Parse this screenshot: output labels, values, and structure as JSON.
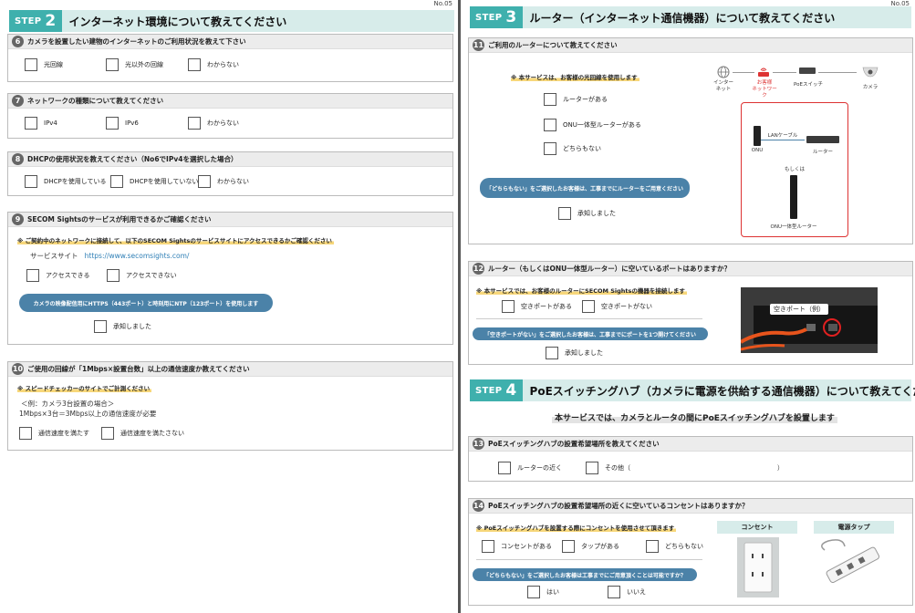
{
  "page_no": "No.05",
  "step2": {
    "badge": "STEP",
    "num": "2",
    "title": "インターネット環境について教えてください",
    "q6": {
      "num": "6",
      "text": "カメラを設置したい建物のインターネットのご利用状況を教えて下さい",
      "opts": [
        "光回線",
        "光以外の回線",
        "わからない"
      ]
    },
    "q7": {
      "num": "7",
      "text": "ネットワークの種類について教えてください",
      "opts": [
        "IPv4",
        "IPv6",
        "わからない"
      ]
    },
    "q8": {
      "num": "8",
      "text": "DHCPの使用状況を教えてください（No6でIPv4を選択した場合）",
      "opts": [
        "DHCPを使用している",
        "DHCPを使用していない",
        "わからない"
      ]
    },
    "q9": {
      "num": "9",
      "text": "SECOM Sightsのサービスが利用できるかご確認ください",
      "note": "※ ご契約中のネットワークに接続して、以下のSECOM Sightsのサービスサイトにアクセスできるかご確認ください",
      "site_label": "サービスサイト",
      "site_url": "https://www.secomsights.com/",
      "opts": [
        "アクセスできる",
        "アクセスできない"
      ],
      "pill": "カメラの映像配信用にHTTPS（443ポート）と時刻用にNTP（123ポート）を使用します",
      "ack": "承知しました"
    },
    "q10": {
      "num": "10",
      "text": "ご使用の回線が「1Mbps×設置台数」以上の通信速度か教えてください",
      "note": "※ スピードチェッカーのサイトでご計測ください",
      "example1": "＜例：カメラ3台設置の場合＞",
      "example2": "1Mbps×3台＝3Mbps以上の通信速度が必要",
      "opts": [
        "通信速度を満たす",
        "通信速度を満たさない"
      ]
    }
  },
  "step3": {
    "badge": "STEP",
    "num": "3",
    "title": "ルーター（インターネット通信機器）について教えてください",
    "q11": {
      "num": "11",
      "text": "ご利用のルーターについて教えてください",
      "note": "※ 本サービスは、お客様の光回線を使用します",
      "opts": [
        "ルーターがある",
        "ONU一体型ルーターがある",
        "どちらもない"
      ],
      "pill": "「どちらもない」をご選択したお客様は、工事までにルーターをご用意ください",
      "ack": "承知しました",
      "diagram": {
        "internet": "インター\nネット",
        "customer_net": "お客様\nネットワーク",
        "poe": "PoEスイッチ",
        "camera": "カメラ",
        "lan": "LANケーブル",
        "onu": "ONU",
        "router": "ルーター",
        "or": "もしくは",
        "onu_router": "ONU一体型ルーター"
      }
    },
    "q12": {
      "num": "12",
      "text": "ルーター（もしくはONU一体型ルーター）に空いているポートはありますか？",
      "note": "※ 本サービスでは、お客様のルーターにSECOM Sightsの機器を接続します",
      "opts": [
        "空きポートがある",
        "空きポートがない"
      ],
      "pill": "「空きポートがない」をご選択したお客様は、工事までにポートを1つ開けてください",
      "ack": "承知しました",
      "photo_label": "空きポート（例）"
    }
  },
  "step4": {
    "badge": "STEP",
    "num": "4",
    "title": "PoEスイッチングハブ（カメラに電源を供給する通信機器）について教えてください",
    "banner": "本サービスでは、カメラとルータの間にPoEスイッチングハブを設置します",
    "q13": {
      "num": "13",
      "text": "PoEスイッチングハブの設置希望場所を教えてください",
      "opts": [
        "ルーターの近く",
        "その他（"
      ],
      "close": "）"
    },
    "q14": {
      "num": "14",
      "text": "PoEスイッチングハブの設置希望場所の近くに空いているコンセントはありますか？",
      "note": "※ PoEスイッチングハブを設置する際にコンセントを使用させて頂きます",
      "opts": [
        "コンセントがある",
        "タップがある",
        "どちらもない"
      ],
      "pill": "「どちらもない」をご選択したお客様は工事までにご用意頂くことは可能ですか？",
      "yesno": [
        "はい",
        "いいえ"
      ],
      "cards": [
        "コンセント",
        "電源タップ"
      ]
    }
  },
  "colors": {
    "teal": "#3fb0ad",
    "teal_light": "#d7ecea",
    "pill_blue": "#4b82a8",
    "highlight": "#f7d77a",
    "red": "#d33"
  }
}
